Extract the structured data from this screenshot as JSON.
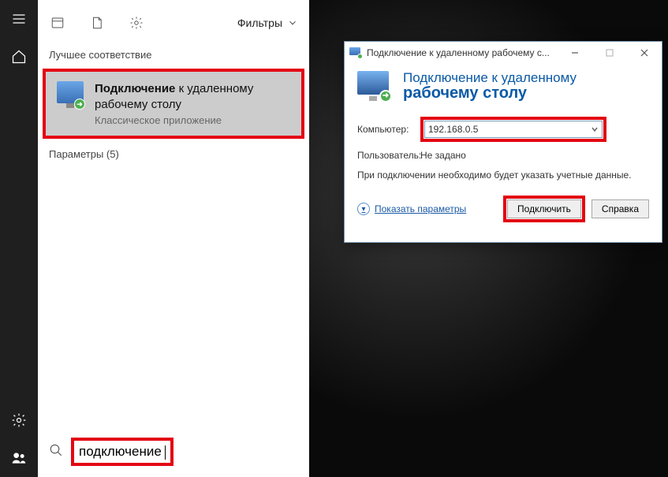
{
  "rail": {
    "items": [
      "menu",
      "home",
      "settings",
      "users"
    ]
  },
  "panel": {
    "filters_label": "Фильтры",
    "best_match_label": "Лучшее соответствие",
    "params_label": "Параметры (5)",
    "result": {
      "bold": "Подключение",
      "rest": " к удаленному рабочему столу",
      "sub": "Классическое приложение"
    },
    "search": {
      "value": "подключение"
    }
  },
  "dialog": {
    "title": "Подключение к удаленному рабочему с...",
    "header_l1": "Подключение к удаленному",
    "header_l2": "рабочему столу",
    "computer_label": "Компьютер:",
    "computer_value": "192.168.0.5",
    "user_label": "Пользователь:",
    "user_value": "Не задано",
    "note": "При подключении необходимо будет указать учетные данные.",
    "show_opts": "Показать параметры",
    "connect": "Подключить",
    "help": "Справка"
  }
}
